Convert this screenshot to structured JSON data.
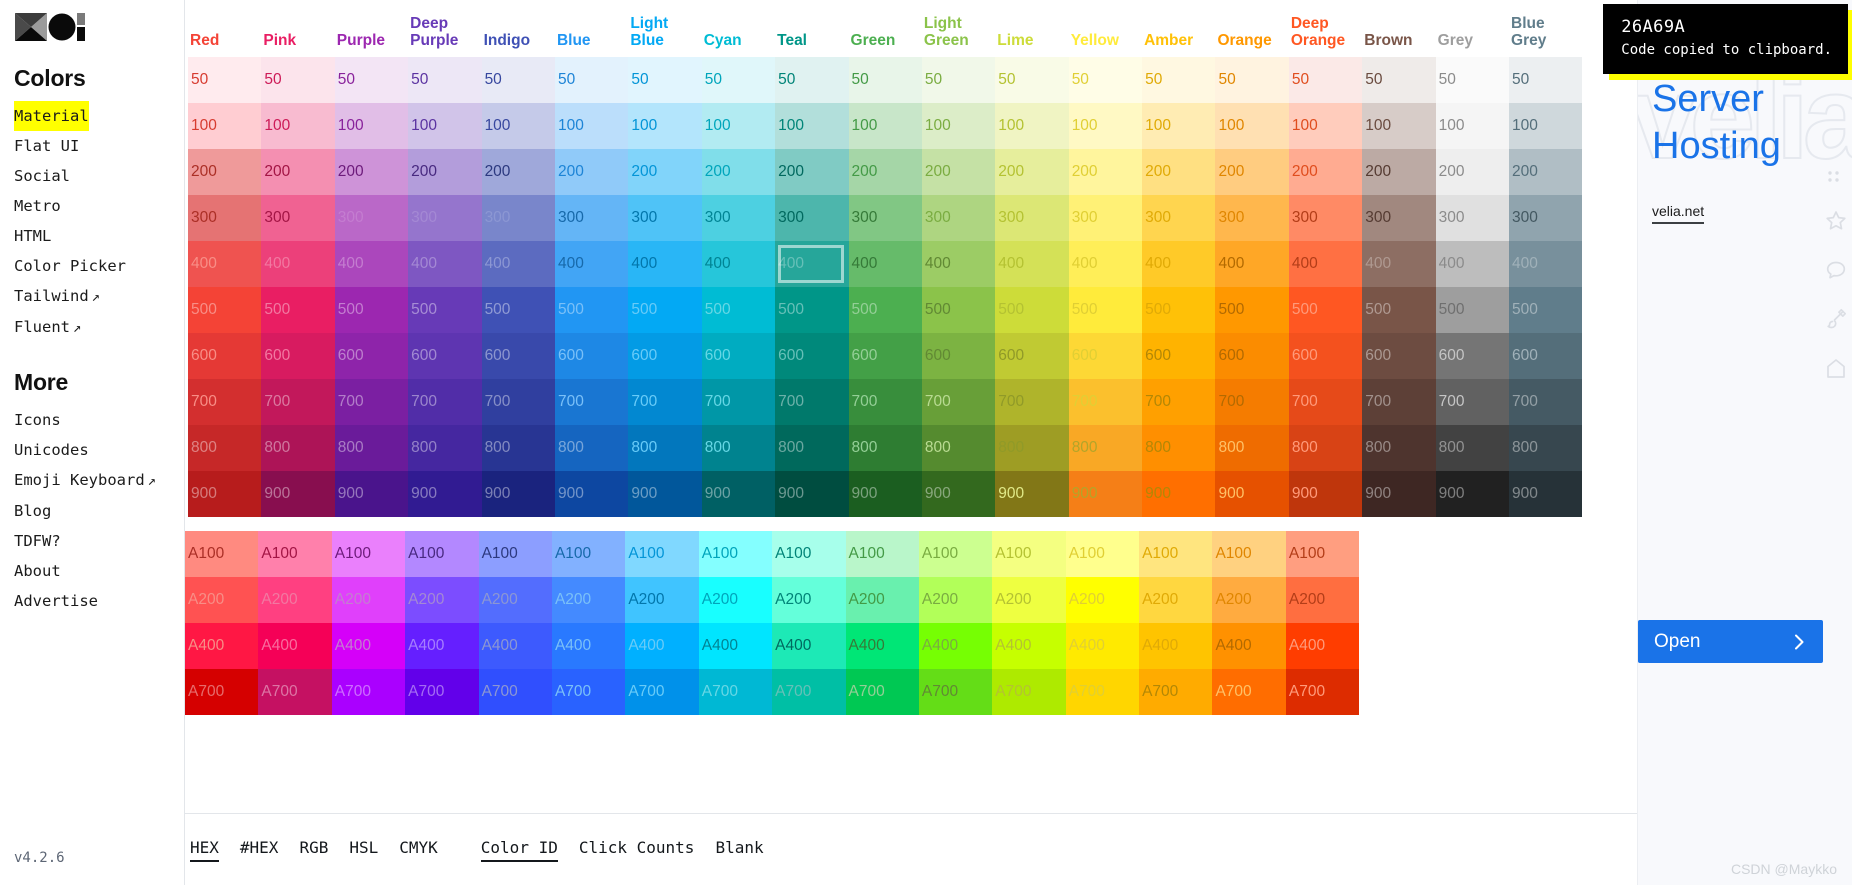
{
  "sidebar": {
    "logo_name": "material-design-logo",
    "colors_heading": "Colors",
    "colors_items": [
      {
        "label": "Material",
        "active": true,
        "external": false
      },
      {
        "label": "Flat UI",
        "active": false,
        "external": false
      },
      {
        "label": "Social",
        "active": false,
        "external": false
      },
      {
        "label": "Metro",
        "active": false,
        "external": false
      },
      {
        "label": "HTML",
        "active": false,
        "external": false
      },
      {
        "label": "Color Picker",
        "active": false,
        "external": false
      },
      {
        "label": "Tailwind",
        "active": false,
        "external": true
      },
      {
        "label": "Fluent",
        "active": false,
        "external": true
      }
    ],
    "more_heading": "More",
    "more_items": [
      {
        "label": "Icons",
        "external": false
      },
      {
        "label": "Unicodes",
        "external": false
      },
      {
        "label": "Emoji Keyboard",
        "external": true
      },
      {
        "label": "Blog",
        "external": false
      },
      {
        "label": "TDFW?",
        "external": false
      },
      {
        "label": "About",
        "external": false
      },
      {
        "label": "Advertise",
        "external": false
      }
    ],
    "external_glyph": "↗",
    "version": "v4.2.6"
  },
  "palette": {
    "shade_rows": [
      "50",
      "100",
      "200",
      "300",
      "400",
      "500",
      "600",
      "700",
      "800",
      "900"
    ],
    "accent_rows": [
      "A100",
      "A200",
      "A400",
      "A700"
    ],
    "selected": {
      "column": "Teal",
      "row": "400",
      "hex": "26A69A"
    },
    "columns": [
      {
        "name": "Red",
        "label": "Red",
        "header_color": "#F44336",
        "shades": [
          "#FFEBEE",
          "#FFCDD2",
          "#EF9A9A",
          "#E57373",
          "#EF5350",
          "#F44336",
          "#E53935",
          "#D32F2F",
          "#C62828",
          "#B71C1C"
        ],
        "accents": [
          "#FF8A80",
          "#FF5252",
          "#FF1744",
          "#D50000"
        ]
      },
      {
        "name": "Pink",
        "label": "Pink",
        "header_color": "#E91E63",
        "shades": [
          "#FCE4EC",
          "#F8BBD0",
          "#F48FB1",
          "#F06292",
          "#EC407A",
          "#E91E63",
          "#D81B60",
          "#C2185B",
          "#AD1457",
          "#880E4F"
        ],
        "accents": [
          "#FF80AB",
          "#FF4081",
          "#F50057",
          "#C51162"
        ]
      },
      {
        "name": "Purple",
        "label": "Purple",
        "header_color": "#9C27B0",
        "shades": [
          "#F3E5F5",
          "#E1BEE7",
          "#CE93D8",
          "#BA68C8",
          "#AB47BC",
          "#9C27B0",
          "#8E24AA",
          "#7B1FA2",
          "#6A1B9A",
          "#4A148C"
        ],
        "accents": [
          "#EA80FC",
          "#E040FB",
          "#D500F9",
          "#AA00FF"
        ]
      },
      {
        "name": "Deep Purple",
        "label": "Deep\nPurple",
        "header_color": "#673AB7",
        "shades": [
          "#EDE7F6",
          "#D1C4E9",
          "#B39DDB",
          "#9575CD",
          "#7E57C2",
          "#673AB7",
          "#5E35B1",
          "#512DA8",
          "#4527A0",
          "#311B92"
        ],
        "accents": [
          "#B388FF",
          "#7C4DFF",
          "#651FFF",
          "#6200EA"
        ]
      },
      {
        "name": "Indigo",
        "label": "Indigo",
        "header_color": "#3F51B5",
        "shades": [
          "#E8EAF6",
          "#C5CAE9",
          "#9FA8DA",
          "#7986CB",
          "#5C6BC0",
          "#3F51B5",
          "#3949AB",
          "#303F9F",
          "#283593",
          "#1A237E"
        ],
        "accents": [
          "#8C9EFF",
          "#536DFE",
          "#3D5AFE",
          "#304FFE"
        ]
      },
      {
        "name": "Blue",
        "label": "Blue",
        "header_color": "#2196F3",
        "shades": [
          "#E3F2FD",
          "#BBDEFB",
          "#90CAF9",
          "#64B5F6",
          "#42A5F5",
          "#2196F3",
          "#1E88E5",
          "#1976D2",
          "#1565C0",
          "#0D47A1"
        ],
        "accents": [
          "#82B1FF",
          "#448AFF",
          "#2979FF",
          "#2962FF"
        ]
      },
      {
        "name": "Light Blue",
        "label": "Light\nBlue",
        "header_color": "#03A9F4",
        "shades": [
          "#E1F5FE",
          "#B3E5FC",
          "#81D4FA",
          "#4FC3F7",
          "#29B6F6",
          "#03A9F4",
          "#039BE5",
          "#0288D1",
          "#0277BD",
          "#01579B"
        ],
        "accents": [
          "#80D8FF",
          "#40C4FF",
          "#00B0FF",
          "#0091EA"
        ]
      },
      {
        "name": "Cyan",
        "label": "Cyan",
        "header_color": "#00BCD4",
        "shades": [
          "#E0F7FA",
          "#B2EBF2",
          "#80DEEA",
          "#4DD0E1",
          "#26C6DA",
          "#00BCD4",
          "#00ACC1",
          "#0097A7",
          "#00838F",
          "#006064"
        ],
        "accents": [
          "#84FFFF",
          "#18FFFF",
          "#00E5FF",
          "#00B8D4"
        ]
      },
      {
        "name": "Teal",
        "label": "Teal",
        "header_color": "#009688",
        "shades": [
          "#E0F2F1",
          "#B2DFDB",
          "#80CBC4",
          "#4DB6AC",
          "#26A69A",
          "#009688",
          "#00897B",
          "#00796B",
          "#00695C",
          "#004D40"
        ],
        "accents": [
          "#A7FFEB",
          "#64FFDA",
          "#1DE9B6",
          "#00BFA5"
        ]
      },
      {
        "name": "Green",
        "label": "Green",
        "header_color": "#4CAF50",
        "shades": [
          "#E8F5E9",
          "#C8E6C9",
          "#A5D6A7",
          "#81C784",
          "#66BB6A",
          "#4CAF50",
          "#43A047",
          "#388E3C",
          "#2E7D32",
          "#1B5E20"
        ],
        "accents": [
          "#B9F6CA",
          "#69F0AE",
          "#00E676",
          "#00C853"
        ]
      },
      {
        "name": "Light Green",
        "label": "Light\nGreen",
        "header_color": "#8BC34A",
        "shades": [
          "#F1F8E9",
          "#DCEDC8",
          "#C5E1A5",
          "#AED581",
          "#9CCC65",
          "#8BC34A",
          "#7CB342",
          "#689F38",
          "#558B2F",
          "#33691E"
        ],
        "accents": [
          "#CCFF90",
          "#B2FF59",
          "#76FF03",
          "#64DD17"
        ]
      },
      {
        "name": "Lime",
        "label": "Lime",
        "header_color": "#CDDC39",
        "shades": [
          "#F9FBE7",
          "#F0F4C3",
          "#E6EE9C",
          "#DCE775",
          "#D4E157",
          "#CDDC39",
          "#C0CA33",
          "#AFB42B",
          "#9E9D24",
          "#827717"
        ],
        "accents": [
          "#F4FF81",
          "#EEFF41",
          "#C6FF00",
          "#AEEA00"
        ]
      },
      {
        "name": "Yellow",
        "label": "Yellow",
        "header_color": "#FFEB3B",
        "shades": [
          "#FFFDE7",
          "#FFF9C4",
          "#FFF59D",
          "#FFF176",
          "#FFEE58",
          "#FFEB3B",
          "#FDD835",
          "#FBC02D",
          "#F9A825",
          "#F57F17"
        ],
        "accents": [
          "#FFFF8D",
          "#FFFF00",
          "#FFEA00",
          "#FFD600"
        ]
      },
      {
        "name": "Amber",
        "label": "Amber",
        "header_color": "#FFC107",
        "shades": [
          "#FFF8E1",
          "#FFECB3",
          "#FFE082",
          "#FFD54F",
          "#FFCA28",
          "#FFC107",
          "#FFB300",
          "#FFA000",
          "#FF8F00",
          "#FF6F00"
        ],
        "accents": [
          "#FFE57F",
          "#FFD740",
          "#FFC400",
          "#FFAB00"
        ]
      },
      {
        "name": "Orange",
        "label": "Orange",
        "header_color": "#FF9800",
        "shades": [
          "#FFF3E0",
          "#FFE0B2",
          "#FFCC80",
          "#FFB74D",
          "#FFA726",
          "#FF9800",
          "#FB8C00",
          "#F57C00",
          "#EF6C00",
          "#E65100"
        ],
        "accents": [
          "#FFD180",
          "#FFAB40",
          "#FF9100",
          "#FF6D00"
        ]
      },
      {
        "name": "Deep Orange",
        "label": "Deep\nOrange",
        "header_color": "#FF5722",
        "shades": [
          "#FBE9E7",
          "#FFCCBC",
          "#FFAB91",
          "#FF8A65",
          "#FF7043",
          "#FF5722",
          "#F4511E",
          "#E64A19",
          "#D84315",
          "#BF360C"
        ],
        "accents": [
          "#FF9E80",
          "#FF6E40",
          "#FF3D00",
          "#DD2C00"
        ]
      },
      {
        "name": "Brown",
        "label": "Brown",
        "header_color": "#795548",
        "shades": [
          "#EFEBE9",
          "#D7CCC8",
          "#BCAAA4",
          "#A1887F",
          "#8D6E63",
          "#795548",
          "#6D4C41",
          "#5D4037",
          "#4E342E",
          "#3E2723"
        ],
        "accents": []
      },
      {
        "name": "Grey",
        "label": "Grey",
        "header_color": "#9E9E9E",
        "shades": [
          "#FAFAFA",
          "#F5F5F5",
          "#EEEEEE",
          "#E0E0E0",
          "#BDBDBD",
          "#9E9E9E",
          "#757575",
          "#616161",
          "#424242",
          "#212121"
        ],
        "accents": []
      },
      {
        "name": "Blue Grey",
        "label": "Blue\nGrey",
        "header_color": "#607D8B",
        "shades": [
          "#ECEFF1",
          "#CFD8DC",
          "#B0BEC5",
          "#90A4AE",
          "#78909C",
          "#607D8B",
          "#546E7A",
          "#455A64",
          "#37474F",
          "#263238"
        ],
        "accents": []
      }
    ]
  },
  "footer": {
    "format_buttons": [
      {
        "label": "HEX",
        "active": true
      },
      {
        "label": "#HEX",
        "active": false
      },
      {
        "label": "RGB",
        "active": false
      },
      {
        "label": "HSL",
        "active": false
      },
      {
        "label": "CMYK",
        "active": false
      }
    ],
    "display_buttons": [
      {
        "label": "Color ID",
        "active": true
      },
      {
        "label": "Click Counts",
        "active": false
      },
      {
        "label": "Blank",
        "active": false
      }
    ]
  },
  "toast": {
    "code": "26A69A",
    "message": "Code copied to clipboard.",
    "background": "#000000",
    "accent": "#FFFF00"
  },
  "ad": {
    "watermark_text": "velia.net",
    "title": "Server Hosting",
    "link": "velia.net",
    "cta_label": "Open",
    "cta_color": "#1A73E8",
    "chevron_glyph": "›",
    "icons": [
      "star-icon",
      "comment-icon",
      "brush-icon",
      "home-icon",
      "more-icon"
    ]
  },
  "watermark": {
    "text": "CSDN @Maykko"
  }
}
